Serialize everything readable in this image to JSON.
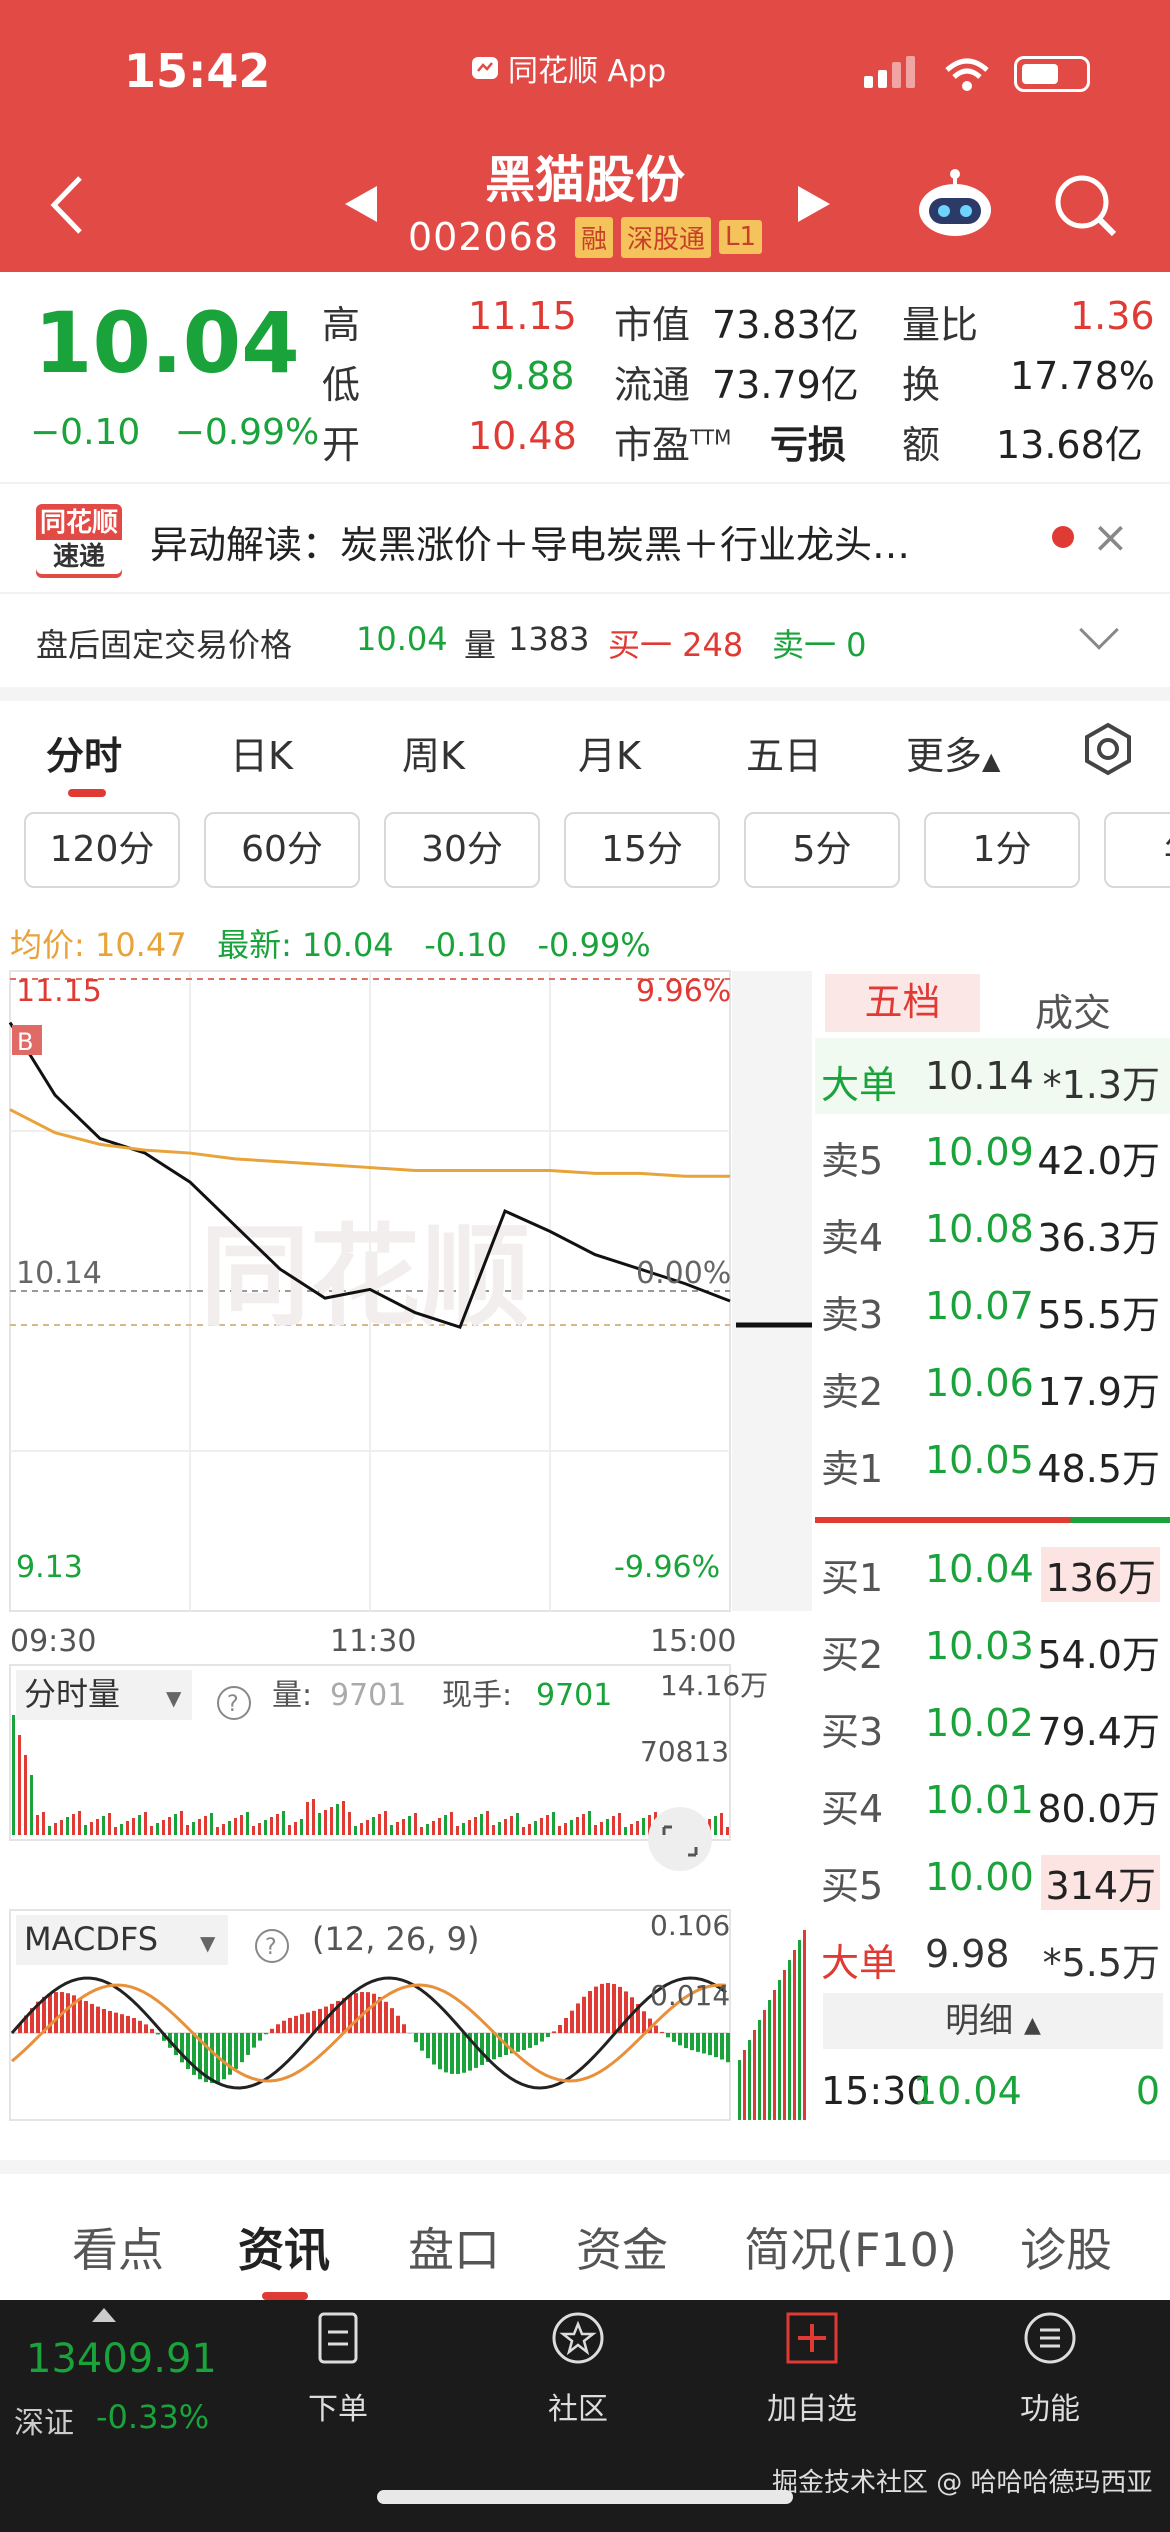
{
  "status_bar": {
    "time": "15:42",
    "app": "同花顺 App"
  },
  "header": {
    "stock_name": "黑猫股份",
    "stock_code": "002068",
    "tags": [
      "融",
      "深股通",
      "L1"
    ]
  },
  "quote": {
    "price": "10.04",
    "change": "−0.10",
    "change_pct": "−0.99%",
    "high_label": "高",
    "high": "11.15",
    "low_label": "低",
    "low": "9.88",
    "open_label": "开",
    "open": "10.48",
    "mcap_label": "市值",
    "mcap": "73.83亿",
    "float_label": "流通",
    "float": "73.79亿",
    "pe_label": "市盈",
    "pe_sup": "TTM",
    "pe": "亏损",
    "vol_ratio_label": "量比",
    "vol_ratio": "1.36",
    "turnover_label": "换",
    "turnover": "17.78%",
    "amount_label": "额",
    "amount": "13.68亿"
  },
  "news": {
    "logo_top": "同花顺",
    "logo_bottom": "速递",
    "text": "异动解读：炭黑涨价＋导电炭黑＋行业龙头…"
  },
  "after_hours": {
    "label": "盘后固定交易价格",
    "price": "10.04",
    "vol_label": "量",
    "vol": "1383",
    "buy1": "买一 248",
    "sell1": "卖一 0"
  },
  "period_tabs": [
    "分时",
    "日K",
    "周K",
    "月K",
    "五日",
    "更多"
  ],
  "minute_chips": [
    "120分",
    "60分",
    "30分",
    "15分",
    "5分",
    "1分",
    "年"
  ],
  "avg_line": {
    "avg": "均价: 10.47",
    "latest": "最新: 10.04",
    "chg": "-0.10",
    "pct": "-0.99%"
  },
  "chart": {
    "high_price": "11.15",
    "high_pct": "9.96%",
    "mid_price": "10.14",
    "mid_pct": "0.00%",
    "low_price": "9.13",
    "low_pct": "-9.96%",
    "b_marker": "B",
    "times": [
      "09:30",
      "11:30",
      "15:00"
    ],
    "watermark": "同花顺",
    "vol_label": "分时量",
    "vol_val_label": "量:",
    "vol_val": "9701",
    "hand_label": "现手:",
    "hand_val": "9701",
    "vol_max": "14.16万",
    "vol_mid": "70813",
    "macd_label": "MACDFS",
    "macd_params": "(12, 26, 9)",
    "macd_max": "0.106",
    "macd_mid": "0.014"
  },
  "chart_data": {
    "type": "line",
    "x": [
      "09:30",
      "09:45",
      "10:00",
      "10:15",
      "10:30",
      "10:45",
      "11:00",
      "11:15",
      "11:30",
      "13:15",
      "13:30",
      "13:45",
      "14:00",
      "14:15",
      "14:30",
      "14:45",
      "15:00"
    ],
    "series": [
      {
        "values": [
          11.0,
          10.75,
          10.6,
          10.55,
          10.45,
          10.3,
          10.15,
          10.05,
          10.08,
          10.0,
          9.95,
          10.35,
          10.28,
          10.2,
          10.15,
          10.1,
          10.04
        ]
      },
      {
        "values": [
          10.7,
          10.62,
          10.58,
          10.56,
          10.55,
          10.53,
          10.52,
          10.51,
          10.5,
          10.49,
          10.49,
          10.49,
          10.49,
          10.48,
          10.48,
          10.47,
          10.47
        ]
      }
    ],
    "ylim": [
      9.13,
      11.15
    ]
  },
  "order_book": {
    "tabs": [
      "五档",
      "成交"
    ],
    "big_sell": {
      "label": "大单",
      "price": "10.14",
      "vol": "*1.3万"
    },
    "asks": [
      {
        "label": "卖5",
        "price": "10.09",
        "vol": "42.0万"
      },
      {
        "label": "卖4",
        "price": "10.08",
        "vol": "36.3万"
      },
      {
        "label": "卖3",
        "price": "10.07",
        "vol": "55.5万"
      },
      {
        "label": "卖2",
        "price": "10.06",
        "vol": "17.9万"
      },
      {
        "label": "卖1",
        "price": "10.05",
        "vol": "48.5万"
      }
    ],
    "bids": [
      {
        "label": "买1",
        "price": "10.04",
        "vol": "136万"
      },
      {
        "label": "买2",
        "price": "10.03",
        "vol": "54.0万"
      },
      {
        "label": "买3",
        "price": "10.02",
        "vol": "79.4万"
      },
      {
        "label": "买4",
        "price": "10.01",
        "vol": "80.0万"
      },
      {
        "label": "买5",
        "price": "10.00",
        "vol": "314万"
      }
    ],
    "big_buy": {
      "label": "大单",
      "price": "9.98",
      "vol": "*5.5万"
    },
    "detail_label": "明细",
    "last_trade": {
      "time": "15:30",
      "price": "10.04",
      "vol": "0"
    }
  },
  "info_tabs": [
    "看点",
    "资讯",
    "盘口",
    "资金",
    "简况(F10)",
    "诊股"
  ],
  "bottom_bar": {
    "index_val": "13409.91",
    "index_name": "深证",
    "index_chg": "-0.33%",
    "items": [
      "下单",
      "社区",
      "加自选",
      "功能"
    ]
  },
  "watermark": "掘金技术社区 @ 哈哈哈德玛西亚",
  "colors": {
    "header_red": "#e24a45",
    "up_red": "#e03a34",
    "down_green": "#19a33a",
    "avg_orange": "#e8a33a"
  }
}
